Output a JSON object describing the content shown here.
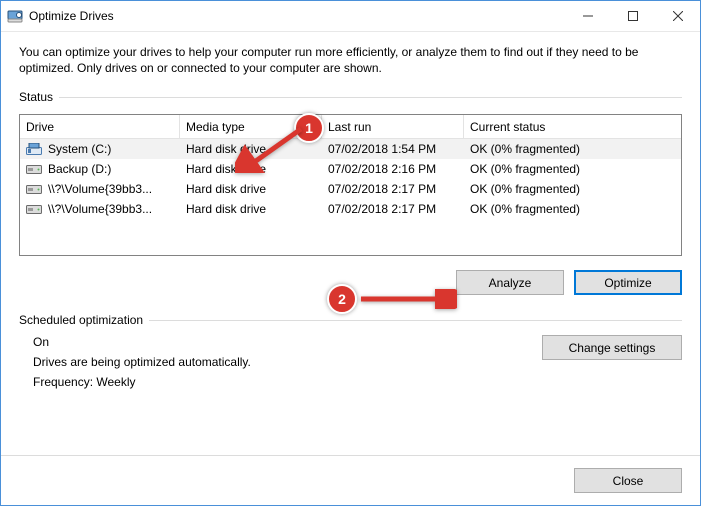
{
  "window": {
    "title": "Optimize Drives"
  },
  "intro": "You can optimize your drives to help your computer run more efficiently, or analyze them to find out if they need to be optimized. Only drives on or connected to your computer are shown.",
  "status": {
    "legend": "Status",
    "columns": {
      "drive": "Drive",
      "media": "Media type",
      "last": "Last run",
      "status": "Current status"
    },
    "rows": [
      {
        "icon": "os-drive",
        "drive": "System (C:)",
        "media": "Hard disk drive",
        "last": "07/02/2018 1:54 PM",
        "status": "OK (0% fragmented)",
        "selected": true
      },
      {
        "icon": "hdd",
        "drive": "Backup (D:)",
        "media": "Hard disk drive",
        "last": "07/02/2018 2:16 PM",
        "status": "OK (0% fragmented)",
        "selected": false
      },
      {
        "icon": "hdd",
        "drive": "\\\\?\\Volume{39bb3...",
        "media": "Hard disk drive",
        "last": "07/02/2018 2:17 PM",
        "status": "OK (0% fragmented)",
        "selected": false
      },
      {
        "icon": "hdd",
        "drive": "\\\\?\\Volume{39bb3...",
        "media": "Hard disk drive",
        "last": "07/02/2018 2:17 PM",
        "status": "OK (0% fragmented)",
        "selected": false
      }
    ],
    "analyze_label": "Analyze",
    "optimize_label": "Optimize"
  },
  "scheduled": {
    "legend": "Scheduled optimization",
    "on": "On",
    "desc": "Drives are being optimized automatically.",
    "freq": "Frequency: Weekly",
    "change_label": "Change settings"
  },
  "footer": {
    "close_label": "Close"
  },
  "annotations": {
    "badge1": "1",
    "badge2": "2"
  }
}
